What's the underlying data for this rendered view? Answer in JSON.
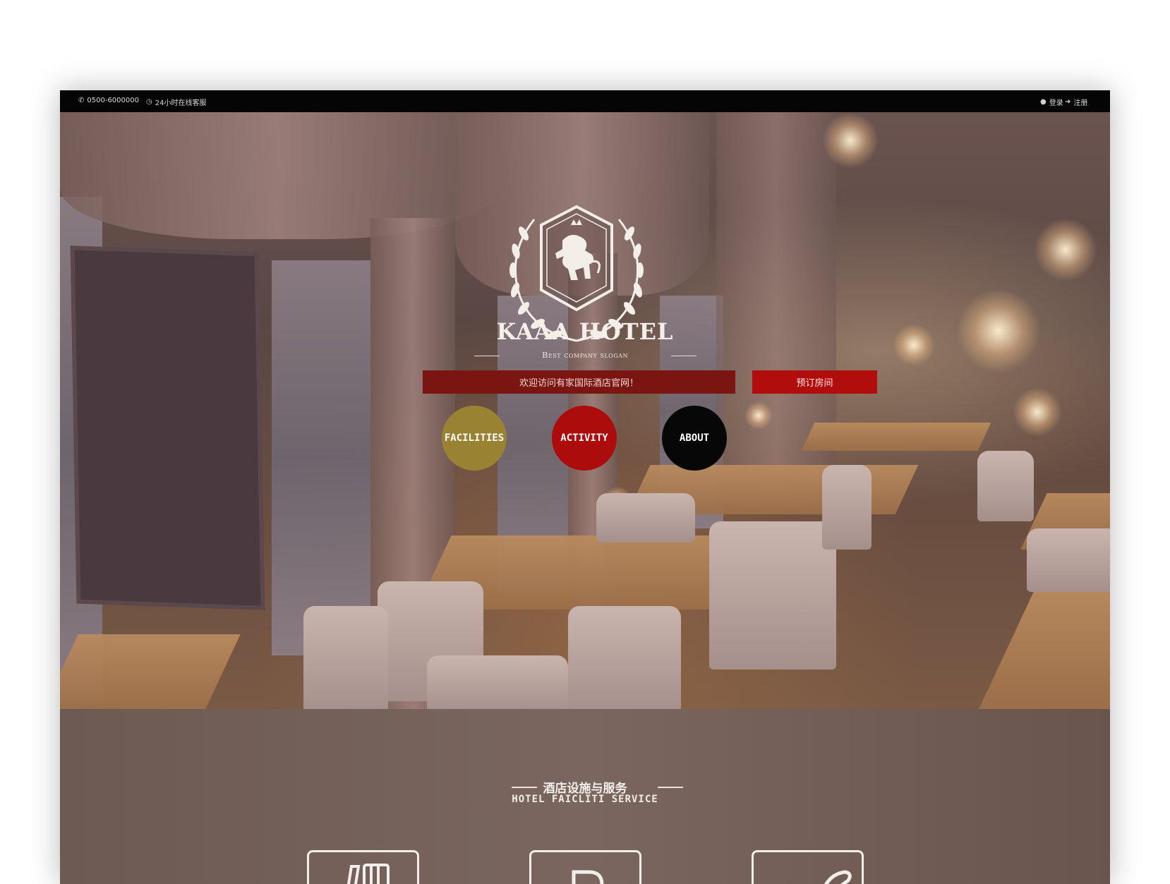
{
  "topbar": {
    "phone_icon": "phone-icon",
    "phone": "0500-6000000",
    "service_icon": "clock-icon",
    "service": "24小时在线客服",
    "login_icon": "user-icon",
    "login": "登录",
    "register_icon": "sign-in-icon",
    "register": "注册"
  },
  "hero": {
    "logo_icon": "lion-crest-icon",
    "brand": "KAAA HOTEL",
    "slogan": "Best company slogan",
    "welcome": "欢迎访问有家国际酒店官网！",
    "book_button": "预订房间",
    "circles": [
      {
        "label": "FACILITIES",
        "color": "#9a8233"
      },
      {
        "label": "ACTIVITY",
        "color": "#ad0c0c"
      },
      {
        "label": "ABOUT",
        "color": "#070707"
      }
    ]
  },
  "service": {
    "title": "酒店设施与服务",
    "subtitle": "HOTEL FAICLITI SERVICE",
    "icons": [
      "restaurant-icon",
      "parking-icon",
      "bath-icon"
    ]
  },
  "colors": {
    "topbar_bg": "#050505",
    "welcome_bg": "#7a1512",
    "book_bg": "#b20d0d",
    "section_bg": "#6e5a52"
  }
}
